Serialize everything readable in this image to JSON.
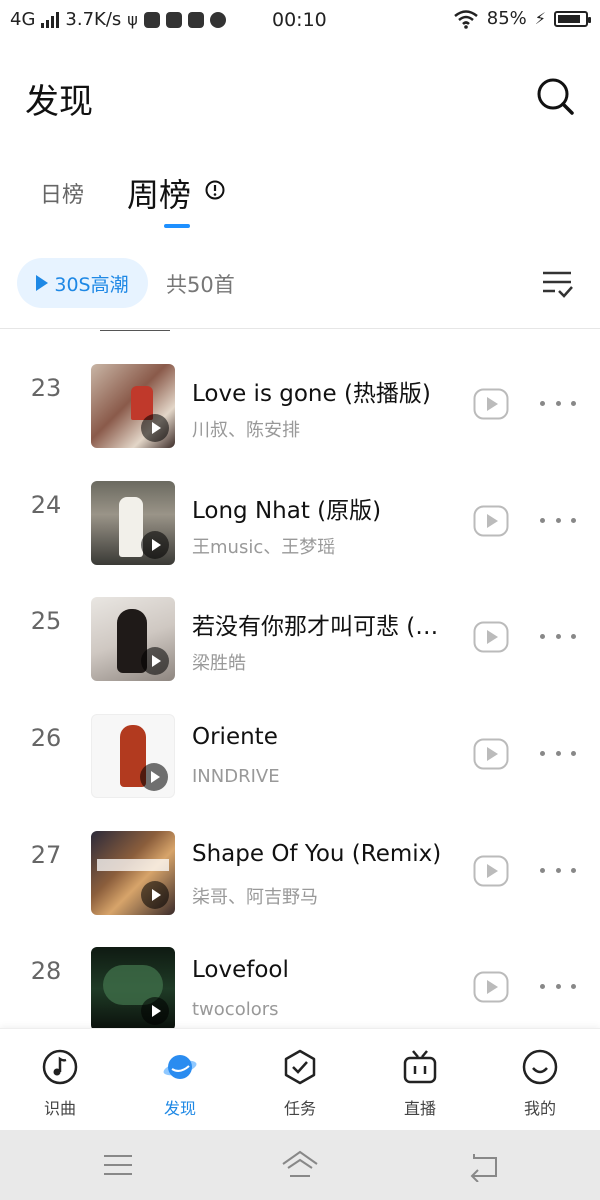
{
  "status_bar": {
    "network": "4G",
    "speed": "3.7K/s",
    "time": "00:10",
    "battery": "85%",
    "battery_level": 0.85
  },
  "header": {
    "title": "发现",
    "search_icon": "search-icon"
  },
  "tabs": {
    "day": "日榜",
    "week": "周榜",
    "active": "周榜"
  },
  "toolbar": {
    "pill_label": "30S高潮",
    "count": "共50首",
    "sort_icon": "sort-check-icon"
  },
  "songs": [
    {
      "rank": "23",
      "title": "Love is gone (热播版)",
      "artist": "川叔、陈安排"
    },
    {
      "rank": "24",
      "title": "Long Nhat (原版)",
      "artist": "王music、王梦瑶"
    },
    {
      "rank": "25",
      "title": "若没有你那才叫可悲 (…",
      "artist": "梁胜皓"
    },
    {
      "rank": "26",
      "title": "Oriente",
      "artist": "INNDRIVE"
    },
    {
      "rank": "27",
      "title": "Shape Of You (Remix)",
      "artist": "柒哥、阿吉野马"
    },
    {
      "rank": "28",
      "title": "Lovefool",
      "artist": "twocolors"
    }
  ],
  "bottom_nav": [
    {
      "label": "识曲",
      "icon": "music-note-icon"
    },
    {
      "label": "发现",
      "icon": "planet-icon",
      "active": true
    },
    {
      "label": "任务",
      "icon": "shield-check-icon"
    },
    {
      "label": "直播",
      "icon": "tv-icon"
    },
    {
      "label": "我的",
      "icon": "smile-icon"
    }
  ],
  "colors": {
    "accent": "#1e88e5",
    "pill_bg": "#e7f3ff",
    "system_nav_bg": "#e9e9e9"
  }
}
